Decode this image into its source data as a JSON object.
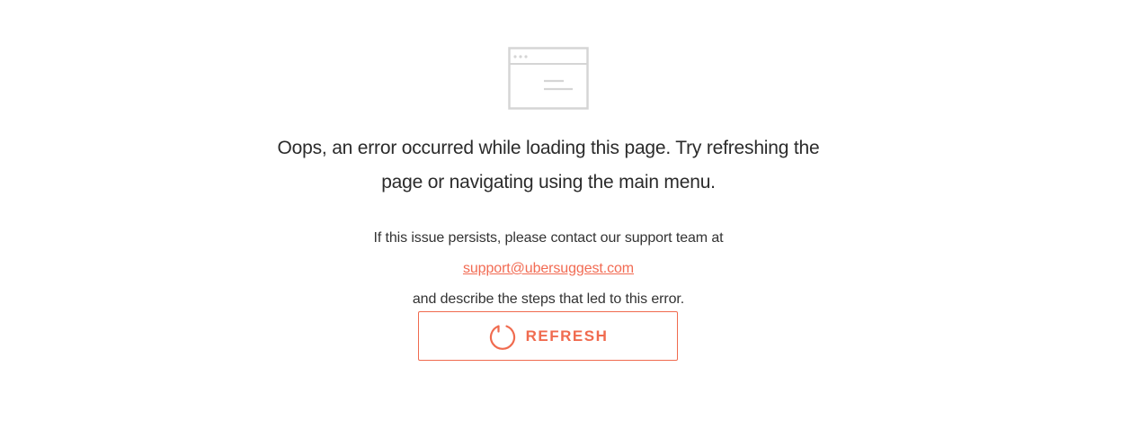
{
  "error": {
    "illustration_icon": "browser-window-icon",
    "headline_line1": "Oops, an error occurred while loading this page. Try refreshing the",
    "headline_line2": "page or navigating using the main menu.",
    "support_line1": "If this issue persists, please contact our support team at",
    "support_email": "support@ubersuggest.com",
    "support_line2_rest": " and describe the steps that led to this error."
  },
  "refresh_button": {
    "label": "REFRESH",
    "icon": "refresh-icon"
  },
  "colors": {
    "accent": "#f06b4f",
    "illustration": "#d5d5d5",
    "text": "#333333"
  }
}
